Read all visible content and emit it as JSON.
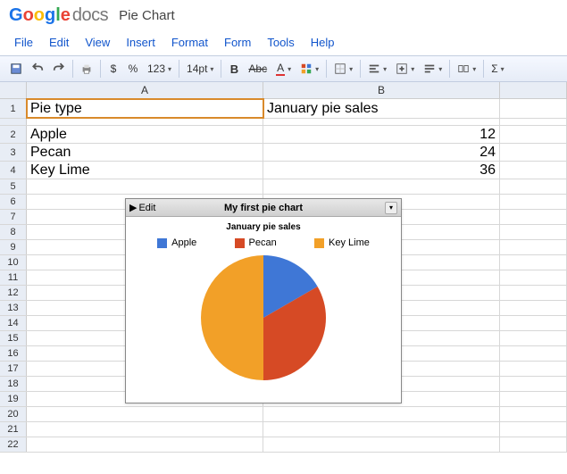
{
  "logo_docs": "docs",
  "doc_title": "Pie Chart",
  "menus": {
    "file": "File",
    "edit": "Edit",
    "view": "View",
    "insert": "Insert",
    "format": "Format",
    "form": "Form",
    "tools": "Tools",
    "help": "Help"
  },
  "toolbar": {
    "currency": "$",
    "percent": "%",
    "more_formats": "123",
    "font_size": "14pt",
    "bold": "B",
    "strike": "Abc",
    "text_color": "A",
    "sigma": "Σ"
  },
  "columns": {
    "A": "A",
    "B": "B"
  },
  "rows": [
    "1",
    "2",
    "3",
    "4",
    "5",
    "6",
    "7",
    "8",
    "9",
    "10",
    "11",
    "12",
    "13",
    "14",
    "15",
    "16",
    "17",
    "18",
    "19",
    "20",
    "21",
    "22"
  ],
  "cells": {
    "A1": "Pie type",
    "B1": "January pie sales",
    "A2": "Apple",
    "B2": "12",
    "A3": "Pecan",
    "B3": "24",
    "A4": "Key Lime",
    "B4": "36"
  },
  "chart": {
    "edit_label": "Edit",
    "title": "My first pie chart",
    "subtitle": "January pie sales",
    "legend": {
      "s1": "Apple",
      "s2": "Pecan",
      "s3": "Key Lime"
    },
    "colors": {
      "apple": "#3f77d6",
      "pecan": "#d64a25",
      "keylime": "#f2a028"
    }
  },
  "chart_data": {
    "type": "pie",
    "title": "My first pie chart",
    "subtitle": "January pie sales",
    "categories": [
      "Apple",
      "Pecan",
      "Key Lime"
    ],
    "values": [
      12,
      24,
      36
    ],
    "colors": [
      "#3f77d6",
      "#d64a25",
      "#f2a028"
    ]
  }
}
